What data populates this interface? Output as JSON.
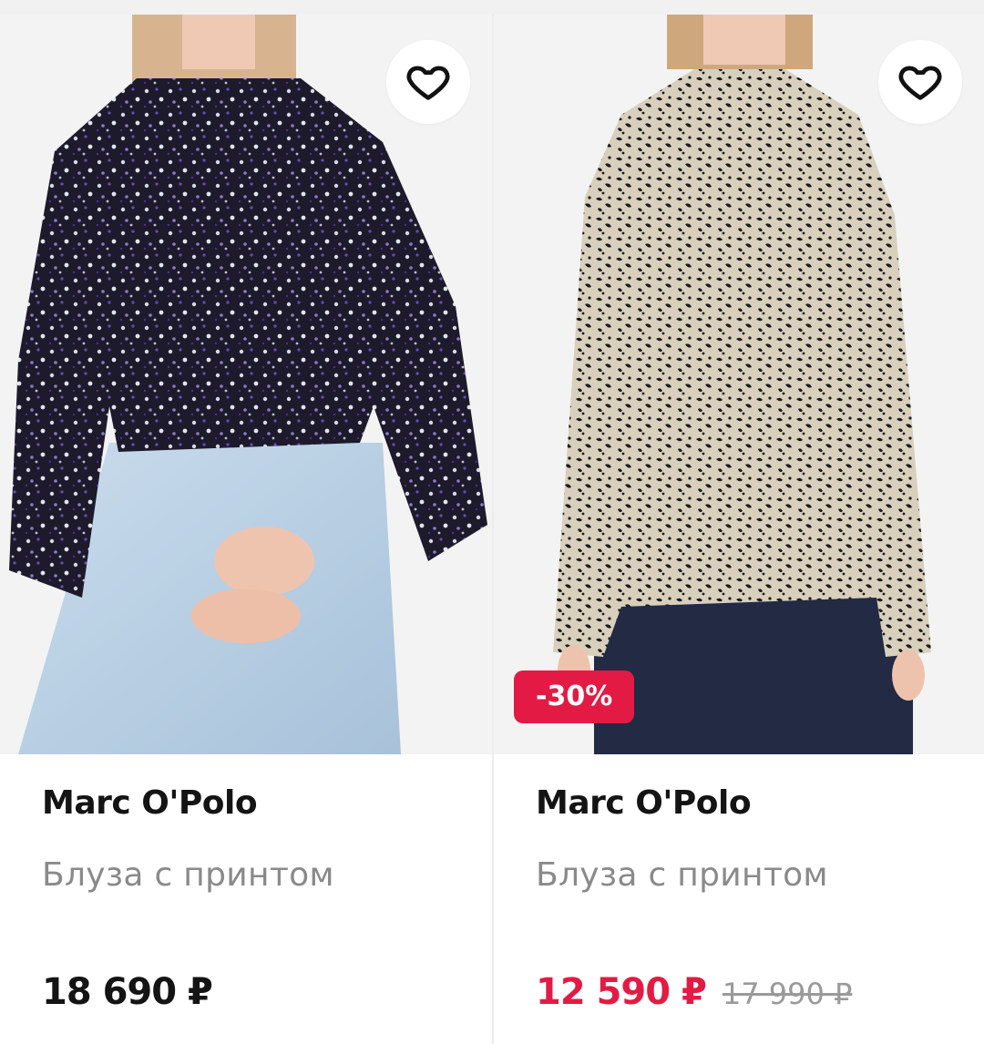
{
  "products": [
    {
      "brand": "Marc O'Polo",
      "title": "Блуза с принтом",
      "price": "18 690 ₽",
      "favorite_icon": "heart-outline-icon",
      "colors": {
        "price": "#141414"
      }
    },
    {
      "brand": "Marc O'Polo",
      "title": "Блуза с принтом",
      "discount_badge": "-30%",
      "price": "12 590 ₽",
      "old_price": "17 990 ₽",
      "favorite_icon": "heart-outline-icon",
      "colors": {
        "price": "#e31b44",
        "badge": "#e31b44"
      }
    }
  ]
}
